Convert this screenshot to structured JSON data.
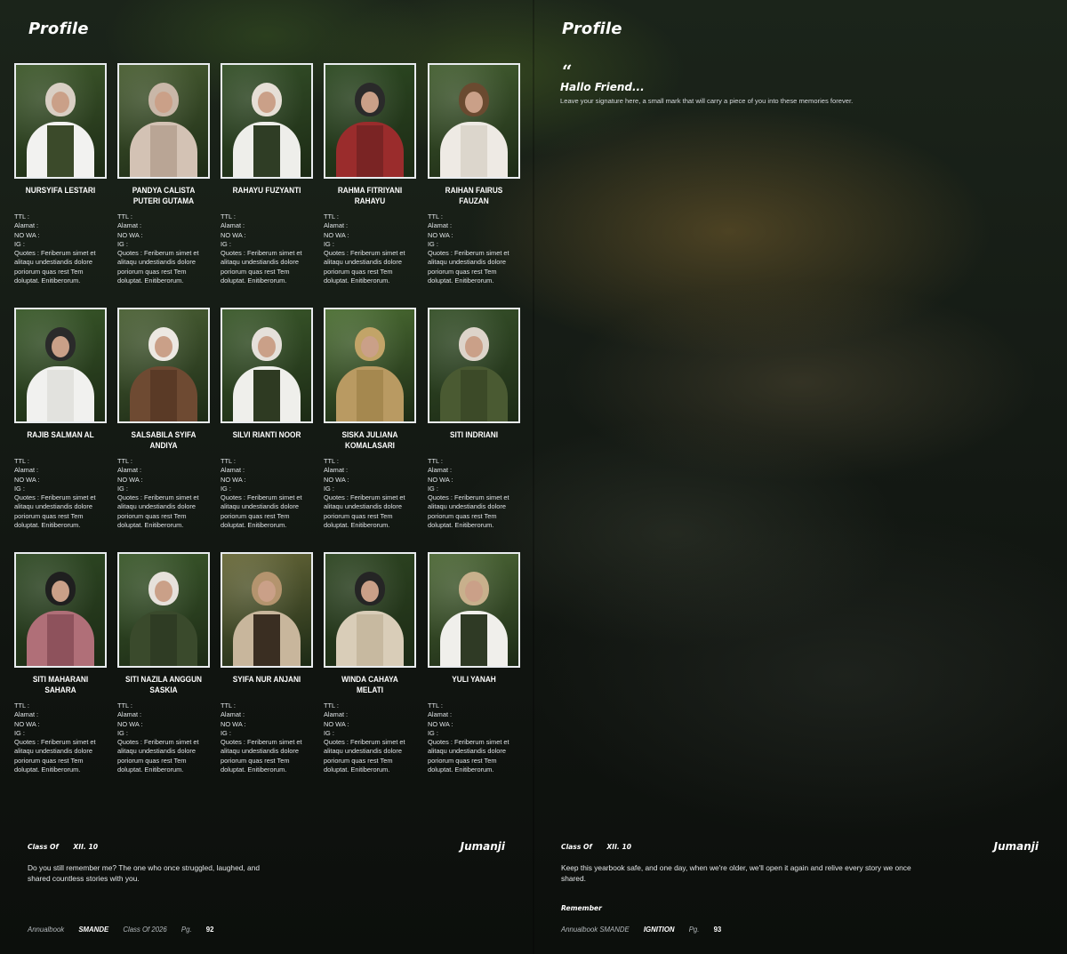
{
  "left_page": {
    "title": "Profile",
    "class_label": "Class Of",
    "class_value": "XII. 10",
    "brand": "Jumanji",
    "paragraph": "Do you still remember me? The one who once struggled, laughed, and shared countless stories with you.",
    "meta": {
      "annual": "Annualbook",
      "school": "SMANDE",
      "class_of": "Class Of 2026",
      "pg_label": "Pg.",
      "pg": "92"
    }
  },
  "right_page": {
    "title": "Profile",
    "quote_mark": "“",
    "hallo": "Hallo Friend...",
    "hallo_sub": "Leave your signature here, a small mark that will carry a piece of you into these memories forever.",
    "class_label": "Class Of",
    "class_value": "XII. 10",
    "brand": "Jumanji",
    "paragraph": "Keep this yearbook safe, and one day, when we're older, we'll open it again and relive every story we once shared.",
    "remember": "Remember",
    "meta": {
      "annual": "Annualbook SMANDE",
      "ignition": "IGNITION",
      "pg_label": "Pg.",
      "pg": "93"
    }
  },
  "field_labels": {
    "ttl": "TTL :",
    "alamat": "Alamat :",
    "nowa": "NO WA :",
    "ig": "IG :",
    "quotes": "Quotes : Feriberum simet et alitaqu undestiandis dolore poriorum quas rest Tem doluptat. Enitiberorum."
  },
  "students": [
    {
      "name": "NURSYIFA LESTARI",
      "bg": "#3f5a2c",
      "hijab": "#d9cfc4",
      "outfit": "#f2f2f0",
      "vest": "#3b4a2a"
    },
    {
      "name": "PANDYA CALISTA PUTERI GUTAMA",
      "bg": "#4a5f33",
      "hijab": "#c9b7a8",
      "outfit": "#d3c2b4",
      "vest": "#b9a595"
    },
    {
      "name": "RAHAYU FUZYANTI",
      "bg": "#345028",
      "hijab": "#e6dfd6",
      "outfit": "#eeeeea",
      "vest": "#2f3d25"
    },
    {
      "name": "RAHMA FITRIYANI RAHAYU",
      "bg": "#2d4a22",
      "hijab": "#2a2a2a",
      "outfit": "#9a2c2c",
      "vest": "#7a2424"
    },
    {
      "name": "RAIHAN FAIRUS FAUZAN",
      "bg": "#456032",
      "hijab": "#6a4a30",
      "outfit": "#eeeae4",
      "vest": "#dcd6cc"
    },
    {
      "name": "RAJIB SALMAN AL",
      "bg": "#3a5a2a",
      "hijab": "#2a2a2a",
      "outfit": "#f1f1ef",
      "vest": "#e2e2de"
    },
    {
      "name": "SALSABILA SYIFA ANDIYA",
      "bg": "#4c6236",
      "hijab": "#ece8e2",
      "outfit": "#6e4a32",
      "vest": "#5a3a26"
    },
    {
      "name": "SILVI RIANTI NOOR",
      "bg": "#3b5a2b",
      "hijab": "#e5e0da",
      "outfit": "#efefeb",
      "vest": "#2e3a22"
    },
    {
      "name": "SISKA JULIANA KOMALASARI",
      "bg": "#4d7034",
      "hijab": "#c2a468",
      "outfit": "#b99a62",
      "vest": "#a5884f"
    },
    {
      "name": "SITI INDRIANI",
      "bg": "#37522a",
      "hijab": "#ddd4ca",
      "outfit": "#4a5a32",
      "vest": "#3c4a28"
    },
    {
      "name": "SITI MAHARANI SAHARA",
      "bg": "#2f4a24",
      "hijab": "#1f1f1f",
      "outfit": "#b06f78",
      "vest": "#8e525c"
    },
    {
      "name": "SITI NAZILA ANGGUN SASKIA",
      "bg": "#3c5a2c",
      "hijab": "#e6e1db",
      "outfit": "#3a4a2c",
      "vest": "#2f3c24"
    },
    {
      "name": "SYIFA NUR ANJANI",
      "bg": "#6a6a3a",
      "hijab": "#b4946e",
      "outfit": "#c8b69c",
      "vest": "#3a2e22"
    },
    {
      "name": "WINDA CAHAYA MELATI",
      "bg": "#2e4622",
      "hijab": "#252525",
      "outfit": "#d9cdb8",
      "vest": "#c7b9a0"
    },
    {
      "name": "YULI YANAH",
      "bg": "#4f6a38",
      "hijab": "#c8b08c",
      "outfit": "#f0efeb",
      "vest": "#2f3a25"
    }
  ]
}
